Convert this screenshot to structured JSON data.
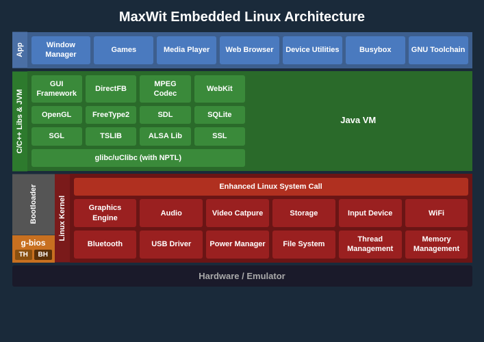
{
  "title": "MaxWit Embedded Linux Architecture",
  "app": {
    "label": "App",
    "cells": [
      {
        "text": "Window Manager"
      },
      {
        "text": "Games"
      },
      {
        "text": "Media Player"
      },
      {
        "text": "Web Browser"
      },
      {
        "text": "Device Utilities"
      },
      {
        "text": "Busybox"
      },
      {
        "text": "GNU Toolchain"
      }
    ]
  },
  "libs": {
    "label": "C/C++ Libs & JVM",
    "row1": [
      {
        "text": "GUI Framework"
      },
      {
        "text": "DirectFB"
      },
      {
        "text": "MPEG Codec"
      },
      {
        "text": "WebKit"
      }
    ],
    "row2": [
      {
        "text": "OpenGL"
      },
      {
        "text": "FreeType2"
      },
      {
        "text": "SDL"
      },
      {
        "text": "SQLite"
      }
    ],
    "row3": [
      {
        "text": "SGL"
      },
      {
        "text": "TSLIB"
      },
      {
        "text": "ALSA Lib"
      },
      {
        "text": "SSL"
      }
    ],
    "row4": [
      {
        "text": "glibc/uClibc (with NPTL)"
      }
    ],
    "javavm": "Java VM"
  },
  "kernel": {
    "label": "Linux Kernel",
    "enhanced": "Enhanced Linux System Call",
    "row1": [
      {
        "text": "Graphics Engine"
      },
      {
        "text": "Audio"
      },
      {
        "text": "Video Catpure"
      },
      {
        "text": "Storage"
      },
      {
        "text": "Input Device"
      },
      {
        "text": "WiFi"
      }
    ],
    "row2": [
      {
        "text": "Bluetooth"
      },
      {
        "text": "USB Driver"
      },
      {
        "text": "Power Manager"
      },
      {
        "text": "File System"
      },
      {
        "text": "Thread Management"
      },
      {
        "text": "Memory Management"
      }
    ]
  },
  "bootloader": {
    "label": "Bootloader",
    "gbios": "g-bios",
    "th": "TH",
    "bh": "BH"
  },
  "hardware": "Hardware / Emulator"
}
